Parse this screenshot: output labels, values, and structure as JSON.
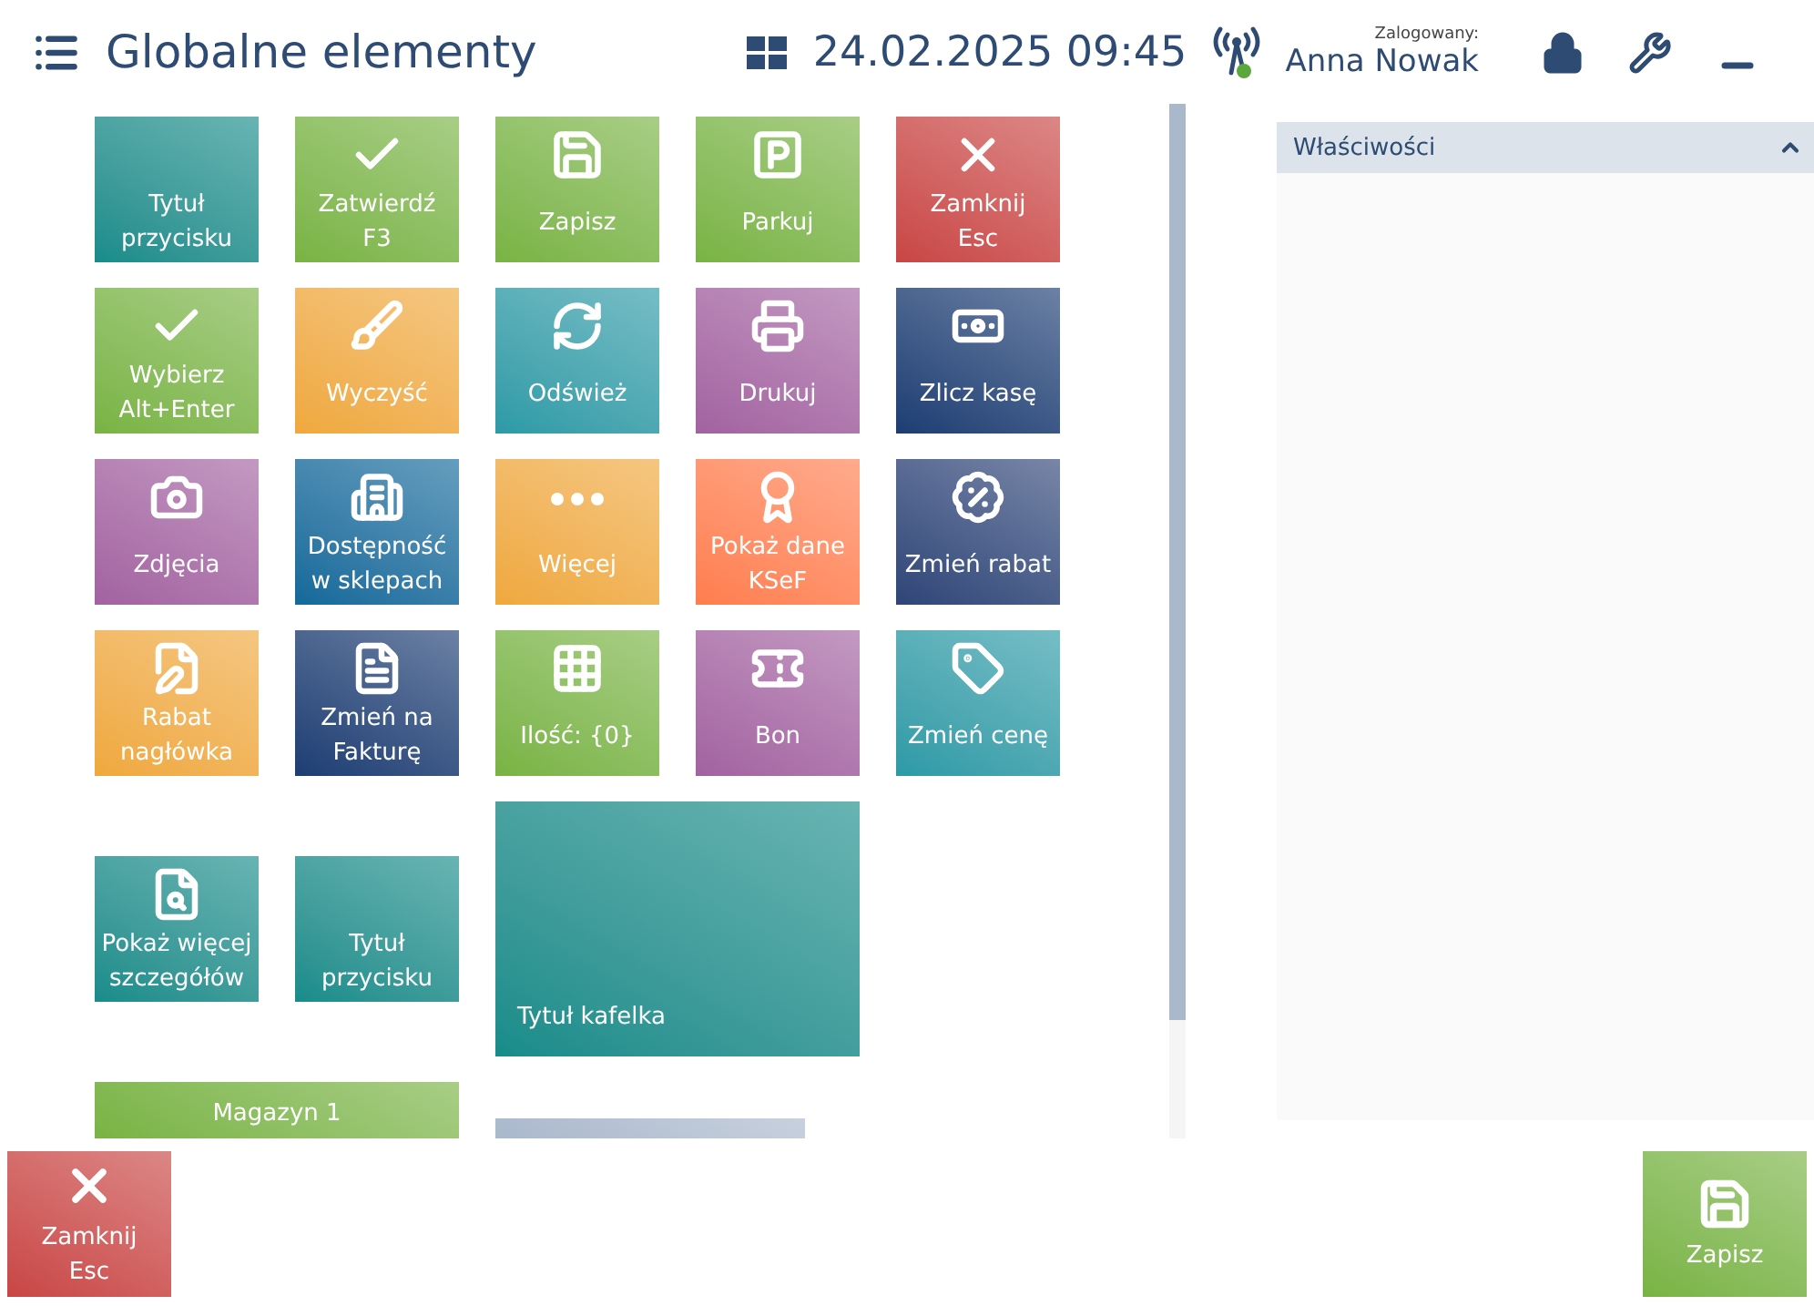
{
  "header": {
    "title": "Globalne elementy",
    "datetime": "24.02.2025 09:45",
    "user_label": "Zalogowany:",
    "user_name": "Anna Nowak"
  },
  "tiles": [
    {
      "kind": "text",
      "label": "Tytuł przycisku",
      "color": "#168c8a"
    },
    {
      "kind": "icon",
      "label": "Zatwierdź\nF3",
      "color": "#79b343"
    },
    {
      "kind": "icon",
      "label": "Zapisz",
      "color": "#79b343"
    },
    {
      "kind": "icon",
      "label": "Parkuj",
      "color": "#79b343"
    },
    {
      "kind": "icon",
      "label": "Zamknij\nEsc",
      "color": "#c84545"
    },
    {
      "kind": "icon",
      "label": "Wybierz\nAlt+Enter",
      "color": "#79b343"
    },
    {
      "kind": "icon",
      "label": "Wyczyść",
      "color": "#efa83c"
    },
    {
      "kind": "icon",
      "label": "Odśwież",
      "color": "#2b9aa6"
    },
    {
      "kind": "icon",
      "label": "Drukuj",
      "color": "#a262a0"
    },
    {
      "kind": "icon",
      "label": "Zlicz kasę",
      "color": "#1d3d72"
    },
    {
      "kind": "icon",
      "label": "Zdjęcia",
      "color": "#a262a0"
    },
    {
      "kind": "icon",
      "label": "Dostępność\nw sklepach",
      "color": "#11699a"
    },
    {
      "kind": "icon",
      "label": "Więcej",
      "color": "#efa83c"
    },
    {
      "kind": "icon",
      "label": "Pokaż dane\nKSeF",
      "color": "#ff7d4e"
    },
    {
      "kind": "icon",
      "label": "Zmień rabat",
      "color": "#2f4577"
    },
    {
      "kind": "icon",
      "label": "Rabat\nnagłówka",
      "color": "#efa83c"
    },
    {
      "kind": "icon",
      "label": "Zmień na\nFakturę",
      "color": "#1d3d72"
    },
    {
      "kind": "icon",
      "label": "Ilość: {0}",
      "color": "#79b343"
    },
    {
      "kind": "icon",
      "label": "Bon",
      "color": "#a262a0"
    },
    {
      "kind": "icon",
      "label": "Zmień cenę",
      "color": "#2b9aa6"
    },
    {
      "kind": "icon",
      "label": "Pokaż więcej\nszczegółów",
      "color": "#168c8a"
    },
    {
      "kind": "text",
      "label": "Tytuł przycisku",
      "color": "#168c8a"
    },
    {
      "kind": "large",
      "label": "Tytuł kafelka",
      "color": "#168c8a"
    },
    {
      "kind": "wide",
      "label": "Magazyn 1",
      "color": "#79b343"
    },
    {
      "kind": "empty",
      "color": "#aab8cc"
    }
  ],
  "panel": {
    "title": "Właściwości",
    "expanded": true
  },
  "footer": [
    {
      "kind": "close",
      "label": "Zamknij\nEsc",
      "color": "#c84545"
    },
    {
      "kind": "save",
      "label": "Zapisz",
      "color": "#79b343"
    }
  ]
}
